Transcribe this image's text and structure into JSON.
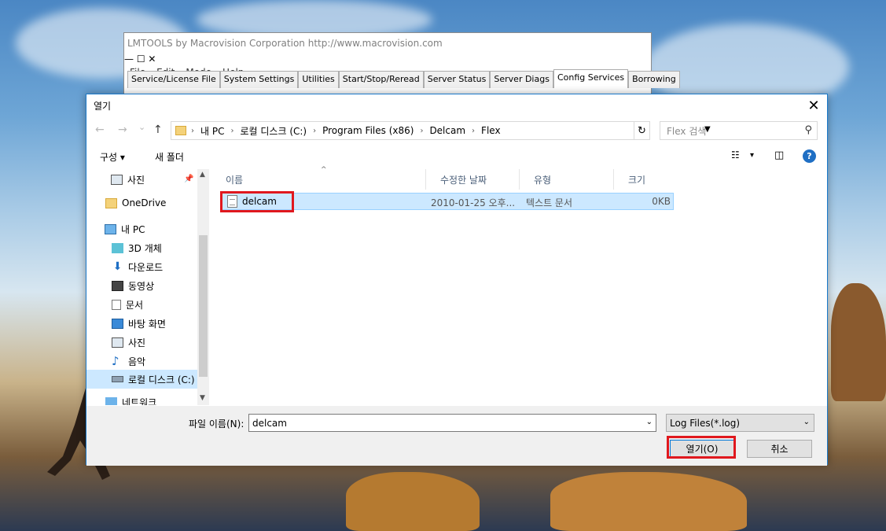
{
  "lmtools": {
    "title": "LMTOOLS by Macrovision Corporation http://www.macrovision.com",
    "controls": {
      "minimize": "—",
      "maximize": "☐",
      "close": "✕"
    },
    "menu": [
      "File",
      "Edit",
      "Mode",
      "Help"
    ],
    "tabs": [
      "Service/License File",
      "System Settings",
      "Utilities",
      "Start/Stop/Reread",
      "Server Status",
      "Server Diags",
      "Config Services",
      "Borrowing"
    ],
    "active_tab": "Config Services"
  },
  "dialog": {
    "title": "열기",
    "close": "✕",
    "nav": {
      "back": "←",
      "forward": "→",
      "recent": "⌄",
      "up": "↑"
    },
    "breadcrumb": [
      "내 PC",
      "로컬 디스크 (C:)",
      "Program Files (x86)",
      "Delcam",
      "Flex"
    ],
    "breadcrumb_sep": "›",
    "search_placeholder": "Flex 검색",
    "toolbar": {
      "organize": "구성 ▾",
      "new_folder": "새 폴더",
      "view": "▾"
    },
    "help": "?",
    "nav_pane": [
      {
        "label": "사진",
        "icon": "pictures-icon"
      },
      {
        "label": "OneDrive",
        "icon": "onedrive-folder-icon"
      },
      {
        "label": "내 PC",
        "icon": "this-pc-icon"
      },
      {
        "label": "3D 개체",
        "icon": "3d-objects-icon"
      },
      {
        "label": "다운로드",
        "icon": "download-icon"
      },
      {
        "label": "동영상",
        "icon": "video-icon"
      },
      {
        "label": "문서",
        "icon": "documents-icon"
      },
      {
        "label": "바탕 화면",
        "icon": "desktop-icon"
      },
      {
        "label": "사진",
        "icon": "pictures-icon"
      },
      {
        "label": "음악",
        "icon": "music-icon"
      },
      {
        "label": "로컬 디스크 (C:)",
        "icon": "local-disk-icon"
      },
      {
        "label": "네트워크",
        "icon": "network-icon"
      }
    ],
    "columns": [
      "이름",
      "수정한 날짜",
      "유형",
      "크기"
    ],
    "files": [
      {
        "name": "delcam",
        "modified": "2010-01-25 오후...",
        "type": "텍스트 문서",
        "size": "0KB"
      }
    ],
    "file_name_label": "파일 이름(N):",
    "file_name_value": "delcam",
    "filter": "Log Files(*.log)",
    "open_button": "열기(O)",
    "cancel_button": "취소"
  }
}
